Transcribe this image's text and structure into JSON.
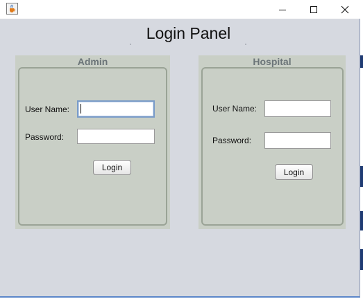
{
  "window": {
    "title": "",
    "app_icon": "java-cup-icon",
    "controls": [
      "minimize-icon",
      "maximize-icon",
      "close-icon"
    ]
  },
  "page": {
    "title": "Login Panel"
  },
  "admin_panel": {
    "title": "Admin",
    "username_label": "User Name:",
    "username_value": "",
    "password_label": "Password:",
    "password_value": "",
    "login_label": "Login"
  },
  "hospital_panel": {
    "title": "Hospital",
    "username_label": "User Name:",
    "username_value": "",
    "password_label": "Password:",
    "password_value": "",
    "login_label": "Login"
  },
  "colors": {
    "window_bg": "#d6d9e0",
    "panel_bg": "#c9cfc6",
    "panel_border": "#9aa396",
    "panel_title": "#6b7478",
    "focus_border": "#7a9cc8"
  }
}
